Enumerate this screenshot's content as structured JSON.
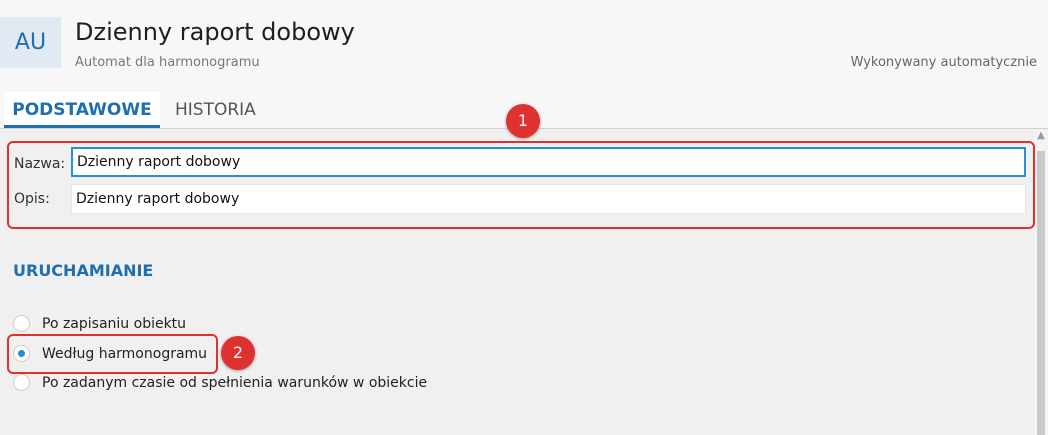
{
  "header": {
    "avatar_text": "AU",
    "title": "Dzienny raport dobowy",
    "subtitle": "Automat dla harmonogramu",
    "status": "Wykonywany automatycznie"
  },
  "tabs": [
    {
      "label": "PODSTAWOWE",
      "active": true
    },
    {
      "label": "HISTORIA",
      "active": false
    }
  ],
  "form": {
    "name_label": "Nazwa:",
    "name_value": "Dzienny raport dobowy",
    "description_label": "Opis:",
    "description_value": "Dzienny raport dobowy"
  },
  "launch": {
    "section_title": "URUCHAMIANIE",
    "options": [
      {
        "label": "Po zapisaniu obiektu",
        "checked": false
      },
      {
        "label": "Według harmonogramu",
        "checked": true
      },
      {
        "label": "Po zadanym czasie od spełnienia warunków w obiekcie",
        "checked": false
      }
    ]
  },
  "callouts": [
    "1",
    "2"
  ],
  "colors": {
    "accent": "#1f6fae",
    "callout": "#e03131",
    "focus_border": "#2b8fd6"
  }
}
